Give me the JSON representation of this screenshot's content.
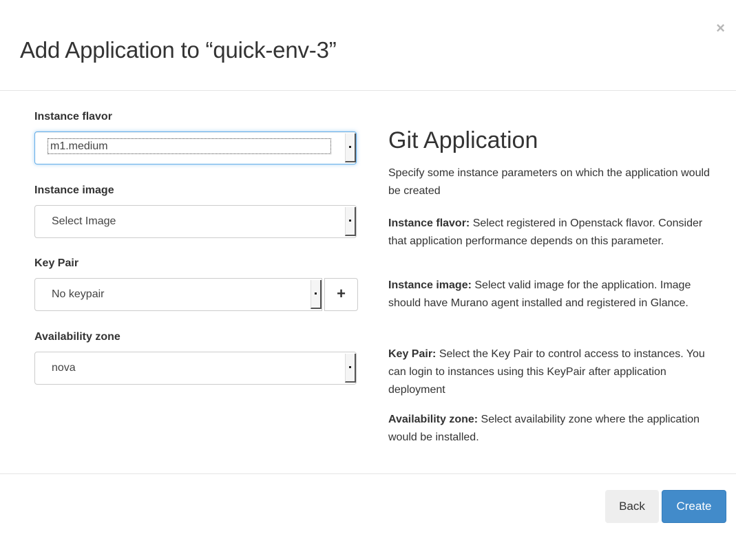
{
  "dialog": {
    "title": "Add Application to “quick-env-3”",
    "close_label": "×"
  },
  "form": {
    "instance_flavor": {
      "label": "Instance flavor",
      "value": "m1.medium"
    },
    "instance_image": {
      "label": "Instance image",
      "value": "Select Image"
    },
    "key_pair": {
      "label": "Key Pair",
      "value": "No keypair",
      "add_label": "+"
    },
    "availability_zone": {
      "label": "Availability zone",
      "value": "nova"
    }
  },
  "help": {
    "title": "Git Application",
    "intro": "Specify some instance parameters on which the application would be created",
    "items": [
      {
        "term": "Instance flavor:",
        "text": " Select registered in Openstack flavor. Consider that application performance depends on this parameter."
      },
      {
        "term": "Instance image:",
        "text": " Select valid image for the application. Image should have Murano agent installed and registered in Glance."
      },
      {
        "term": "Key Pair:",
        "text": " Select the Key Pair to control access to instances. You can login to instances using this KeyPair after application deployment"
      },
      {
        "term": "Availability zone:",
        "text": " Select availability zone where the application would be installed."
      }
    ]
  },
  "footer": {
    "back_label": "Back",
    "create_label": "Create"
  },
  "colors": {
    "primary": "#428bca",
    "focus_border": "#66afe9"
  },
  "icons": {
    "close": "close-icon",
    "add": "plus-icon",
    "dropdown": "dropdown-arrow-icon"
  }
}
